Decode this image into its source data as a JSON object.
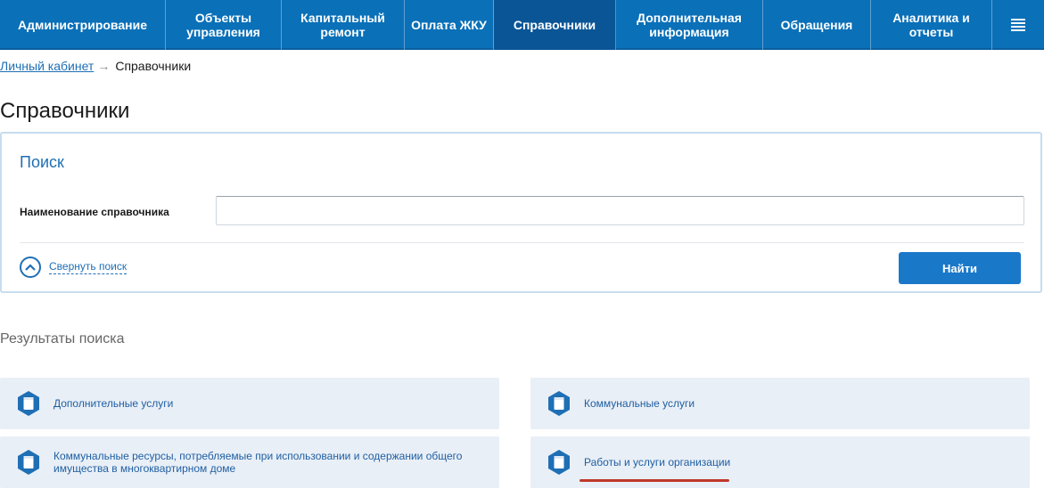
{
  "nav": {
    "items": [
      {
        "label": "Администрирование"
      },
      {
        "label": "Объекты\nуправления"
      },
      {
        "label": "Капитальный\nремонт"
      },
      {
        "label": "Оплата ЖКУ"
      },
      {
        "label": "Справочники"
      },
      {
        "label": "Дополнительная\nинформация"
      },
      {
        "label": "Обращения"
      },
      {
        "label": "Аналитика и\nотчеты"
      }
    ],
    "active": "Справочники",
    "menu_icon": "hamburger-icon"
  },
  "breadcrumb": {
    "link": "Личный кабинет",
    "separator": "→",
    "current": "Справочники"
  },
  "page": {
    "title": "Справочники"
  },
  "search": {
    "title": "Поиск",
    "field_label": "Наименование справочника",
    "field_value": "",
    "collapse_label": "Свернуть поиск",
    "find_button": "Найти"
  },
  "results": {
    "title": "Результаты поиска",
    "items": [
      {
        "label": "Дополнительные услуги"
      },
      {
        "label": "Коммунальные услуги"
      },
      {
        "label": "Коммунальные ресурсы, потребляемые при использовании и содержании общего имущества в многоквартирном доме"
      },
      {
        "label": "Работы и услуги организации"
      }
    ]
  },
  "colors": {
    "nav_bg": "#0a70b8",
    "nav_active": "#0a5596",
    "accent": "#1f6fb5",
    "button": "#1a78c9",
    "card_bg": "#e9eff6",
    "highlight_underline": "#c0392b"
  }
}
